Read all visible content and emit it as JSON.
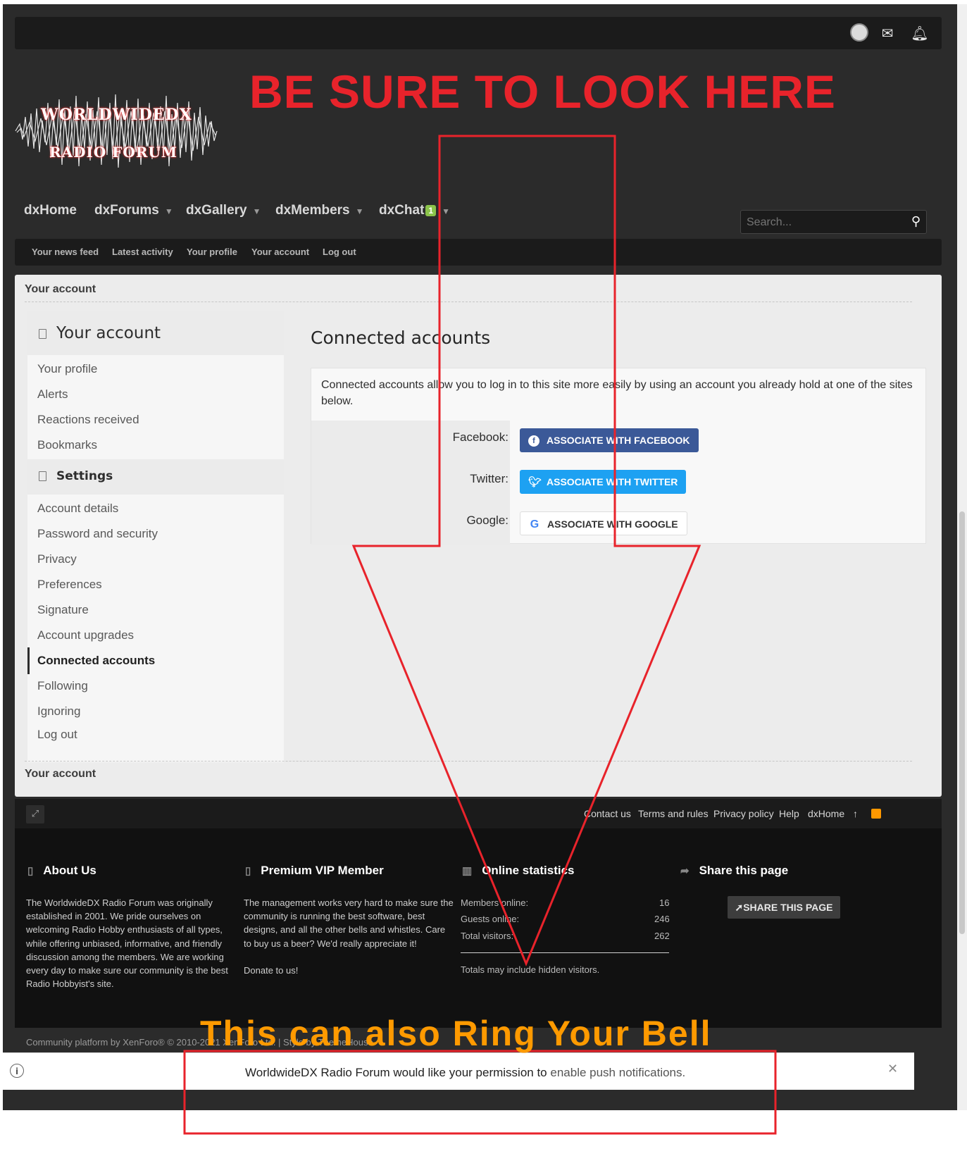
{
  "headline": "BE SURE TO LOOK HERE",
  "logo": {
    "line1": "WORLDWIDEDX",
    "line2": "RADIO FORUM"
  },
  "nav": {
    "items": [
      {
        "label": "dxHome",
        "caret": false
      },
      {
        "label": "dxForums",
        "caret": true
      },
      {
        "label": "dxGallery",
        "caret": true
      },
      {
        "label": "dxMembers",
        "caret": true
      },
      {
        "label": "dxChat",
        "caret": true,
        "badge": "1"
      }
    ]
  },
  "search": {
    "placeholder": "Search..."
  },
  "subnav": [
    "Your news feed",
    "Latest activity",
    "Your profile",
    "Your account",
    "Log out"
  ],
  "breadcrumb": "Your account",
  "sidebar": {
    "header1": "Your account",
    "items1": [
      "Your profile",
      "Alerts",
      "Reactions received",
      "Bookmarks"
    ],
    "header2": "Settings",
    "items2": [
      "Account details",
      "Password and security",
      "Privacy",
      "Preferences",
      "Signature",
      "Account upgrades",
      "Connected accounts",
      "Following",
      "Ignoring",
      "Log out"
    ],
    "active": "Connected accounts"
  },
  "main": {
    "title": "Connected accounts",
    "description": "Connected accounts allow you to log in to this site more easily by using an account you already hold at one of the sites below.",
    "providers": [
      {
        "label": "Facebook:",
        "button": "ASSOCIATE WITH FACEBOOK"
      },
      {
        "label": "Twitter:",
        "button": "ASSOCIATE WITH TWITTER"
      },
      {
        "label": "Google:",
        "button": "ASSOCIATE WITH GOOGLE"
      }
    ]
  },
  "footer_links": [
    "Contact us",
    "Terms and rules",
    "Privacy policy",
    "Help",
    "dxHome"
  ],
  "footer": {
    "about_title": "About Us",
    "about_text": "The WorldwideDX Radio Forum was originally established in 2001. We pride ourselves on welcoming Radio Hobby enthusiasts of all types, while offering unbiased, informative, and friendly discussion among the members. We are working every day to make sure our community is the best Radio Hobbyist's site.",
    "vip_title": "Premium VIP Member",
    "vip_text": "The management works very hard to make sure the community is running the best software, best designs, and all the other bells and whistles. Care to buy us a beer? We'd really appreciate it!",
    "donate": "Donate to us!",
    "stats_title": "Online statistics",
    "stats": [
      {
        "label": "Members online:",
        "value": "16"
      },
      {
        "label": "Guests online:",
        "value": "246"
      },
      {
        "label": "Total visitors:",
        "value": "262"
      }
    ],
    "stats_note": "Totals may include hidden visitors.",
    "share_title": "Share this page",
    "share_button": "SHARE THIS PAGE"
  },
  "copyright": "Community platform by XenForo® © 2010-2021 XenForo Ltd. | Style by ThemeHouse",
  "notification": {
    "text": "WorldwideDX Radio Forum would like your permission to",
    "link": "enable push notifications."
  },
  "annotation_bottom": "This can also Ring Your Bell",
  "colors": {
    "annotation_red": "#e8232b",
    "annotation_orange": "#ff9a00"
  }
}
